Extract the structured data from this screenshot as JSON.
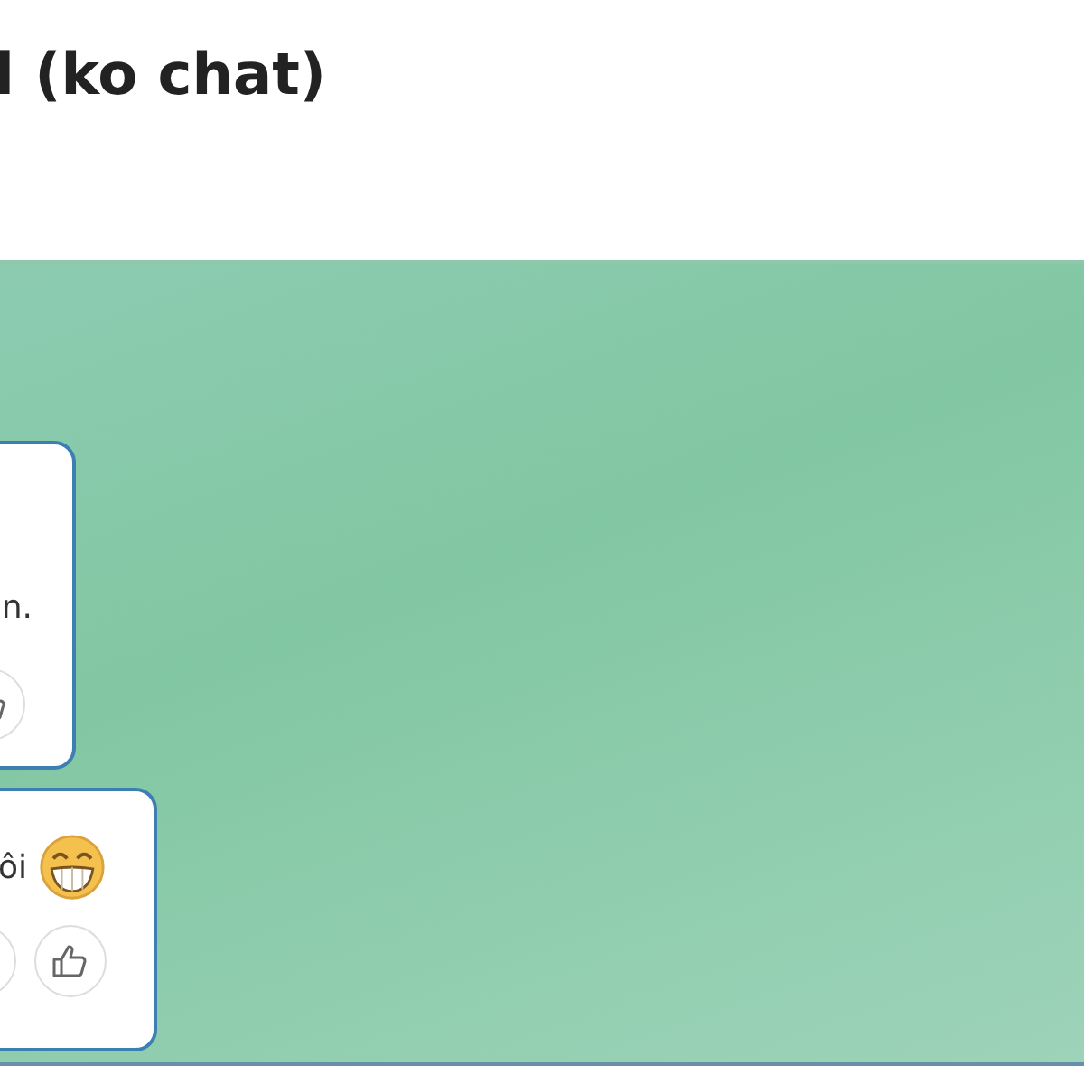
{
  "header": {
    "title": "l (ko chat)"
  },
  "messages": [
    {
      "text": "n.",
      "reactions": [
        {
          "kind": "like"
        }
      ]
    },
    {
      "text": "ôi",
      "emoji": {
        "kind": "grin"
      },
      "reactions": [
        {
          "kind": "blank"
        },
        {
          "kind": "like"
        }
      ]
    }
  ]
}
